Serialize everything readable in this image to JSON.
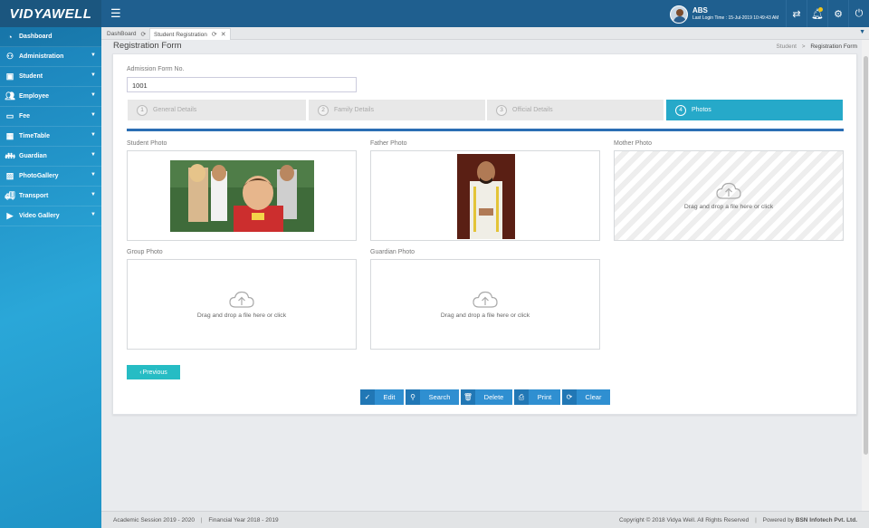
{
  "app": {
    "logo": "VIDYAWELL"
  },
  "user": {
    "name": "ABS",
    "last_login": "Last Login Time : 15-Jul-2019 10:49:43 AM"
  },
  "tabs": [
    {
      "label": "DashBoard"
    },
    {
      "label": "Student Registration"
    }
  ],
  "sidebar": {
    "items": [
      {
        "label": "Dashboard",
        "icon": "dashboard-icon"
      },
      {
        "label": "Administration",
        "icon": "admin-icon"
      },
      {
        "label": "Student",
        "icon": "student-icon"
      },
      {
        "label": "Employee",
        "icon": "employee-icon"
      },
      {
        "label": "Fee",
        "icon": "money-icon"
      },
      {
        "label": "TimeTable",
        "icon": "calendar-icon"
      },
      {
        "label": "Guardian",
        "icon": "guardian-icon"
      },
      {
        "label": "PhotoGallery",
        "icon": "gallery-icon"
      },
      {
        "label": "Transport",
        "icon": "truck-icon"
      },
      {
        "label": "Video Gallery",
        "icon": "video-icon"
      }
    ]
  },
  "page": {
    "title": "Registration Form",
    "breadcrumb": [
      "Student",
      "Registration Form"
    ]
  },
  "form": {
    "admission_label": "Admission Form No.",
    "admission_value": "1001"
  },
  "steps": [
    {
      "num": "1",
      "label": "General Details"
    },
    {
      "num": "2",
      "label": "Family Details"
    },
    {
      "num": "3",
      "label": "Official Details"
    },
    {
      "num": "4",
      "label": "Photos",
      "active": true
    }
  ],
  "photos": {
    "student_label": "Student Photo",
    "father_label": "Father Photo",
    "mother_label": "Mother Photo",
    "group_label": "Group Photo",
    "guardian_label": "Guardian Photo",
    "drop_text": "Drag and drop a file here or click"
  },
  "buttons": {
    "previous": "Previous",
    "edit": "Edit",
    "search": "Search",
    "delete": "Delete",
    "print": "Print",
    "clear": "Clear"
  },
  "footer": {
    "session": "Academic Session 2019 - 2020",
    "financial": "Financial Year 2018 - 2019",
    "copyright": "Copyright © 2018 Vidya Well. All Rights Reserved",
    "powered_prefix": "Powered by",
    "powered_by": "BSN Infotech Pvt. Ltd."
  }
}
